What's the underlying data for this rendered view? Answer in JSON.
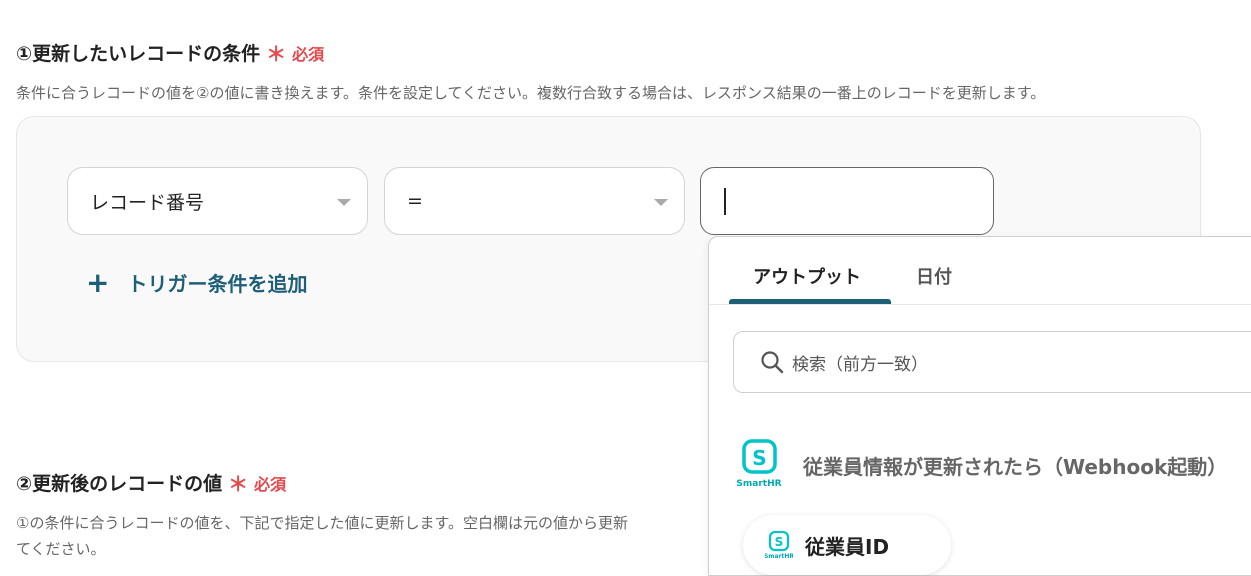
{
  "section1": {
    "title": "①更新したいレコードの条件",
    "required_mark": "＊",
    "required_text": "必須",
    "description": "条件に合うレコードの値を②の値に書き換えます。条件を設定してください。複数行合致する場合は、レスポンス結果の一番上のレコードを更新します。"
  },
  "condition": {
    "field_value": "レコード番号",
    "operator_value": "=",
    "value_input": "",
    "add_label": "トリガー条件を追加"
  },
  "section2": {
    "title": "②更新後のレコードの値",
    "required_mark": "＊",
    "required_text": "必須",
    "description_line1": "①の条件に合うレコードの値を、下記で指定した値に更新します。空白欄は元の値から更新",
    "description_line2": "てください。"
  },
  "panel": {
    "tabs": [
      "アウトプット",
      "日付"
    ],
    "active_tab": 0,
    "search_placeholder": "検索（前方一致）",
    "source_title": "従業員情報が更新されたら（Webhook起動）",
    "logo_text": "SmartHR",
    "item_label": "従業員ID"
  },
  "colors": {
    "accent": "#1e5f78",
    "required": "#e5484d",
    "smarthr": "#00c4cc"
  }
}
